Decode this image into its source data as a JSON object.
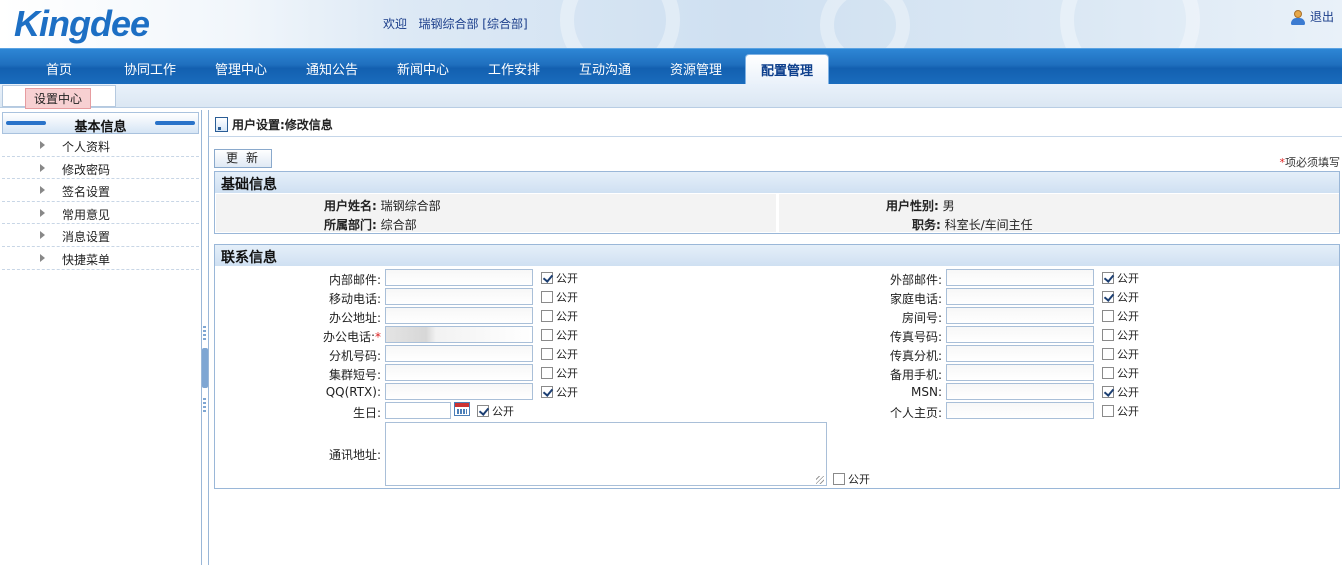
{
  "header": {
    "logo": "Kingdee",
    "welcome": "欢迎   瑞钢综合部 [综合部]",
    "logout": "退出"
  },
  "nav": {
    "items": [
      "首页",
      "协同工作",
      "管理中心",
      "通知公告",
      "新闻中心",
      "工作安排",
      "互动沟通",
      "资源管理",
      "配置管理"
    ],
    "active": "配置管理"
  },
  "subbar": {
    "tab": "设置中心"
  },
  "sidebar": {
    "title": "基本信息",
    "items": [
      "个人资料",
      "修改密码",
      "签名设置",
      "常用意见",
      "消息设置",
      "快捷菜单"
    ]
  },
  "main": {
    "title": "用户设置:修改信息",
    "update_button": "更新",
    "required_note": "项必须填写",
    "required_star": "*"
  },
  "basic_info": {
    "title": "基础信息",
    "name_label": "用户姓名:",
    "name_value": "瑞钢综合部",
    "gender_label": "用户性别:",
    "gender_value": "男",
    "dept_label": "所属部门:",
    "dept_value": "综合部",
    "position_label": "职务:",
    "position_value": "科室长/车间主任"
  },
  "contact": {
    "title": "联系信息",
    "public_label": "公开",
    "left": [
      {
        "label": "内部邮件:",
        "value": "",
        "public": true
      },
      {
        "label": "移动电话:",
        "value": "",
        "public": false
      },
      {
        "label": "办公地址:",
        "value": "",
        "public": false
      },
      {
        "label": "办公电话:",
        "value": "",
        "public": false,
        "required": true
      },
      {
        "label": "分机号码:",
        "value": "",
        "public": false
      },
      {
        "label": "集群短号:",
        "value": "",
        "public": false
      },
      {
        "label": "QQ(RTX):",
        "value": "",
        "public": true
      }
    ],
    "right": [
      {
        "label": "外部邮件:",
        "value": "",
        "public": true
      },
      {
        "label": "家庭电话:",
        "value": "",
        "public": true
      },
      {
        "label": "房间号:",
        "value": "",
        "public": false
      },
      {
        "label": "传真号码:",
        "value": "",
        "public": false
      },
      {
        "label": "传真分机:",
        "value": "",
        "public": false
      },
      {
        "label": "备用手机:",
        "value": "",
        "public": false
      },
      {
        "label": "MSN:",
        "value": "",
        "public": true
      },
      {
        "label": "个人主页:",
        "value": "",
        "public": false
      }
    ],
    "birthday_label": "生日:",
    "birthday_value": "",
    "birthday_public": true,
    "address_label": "通讯地址:",
    "address_value": "",
    "address_public": false
  },
  "colors": {
    "nav_blue": "#1f6fbe",
    "logo_blue": "#1d6fc4",
    "section_border": "#9ab7d8",
    "required_red": "#dd2222"
  }
}
